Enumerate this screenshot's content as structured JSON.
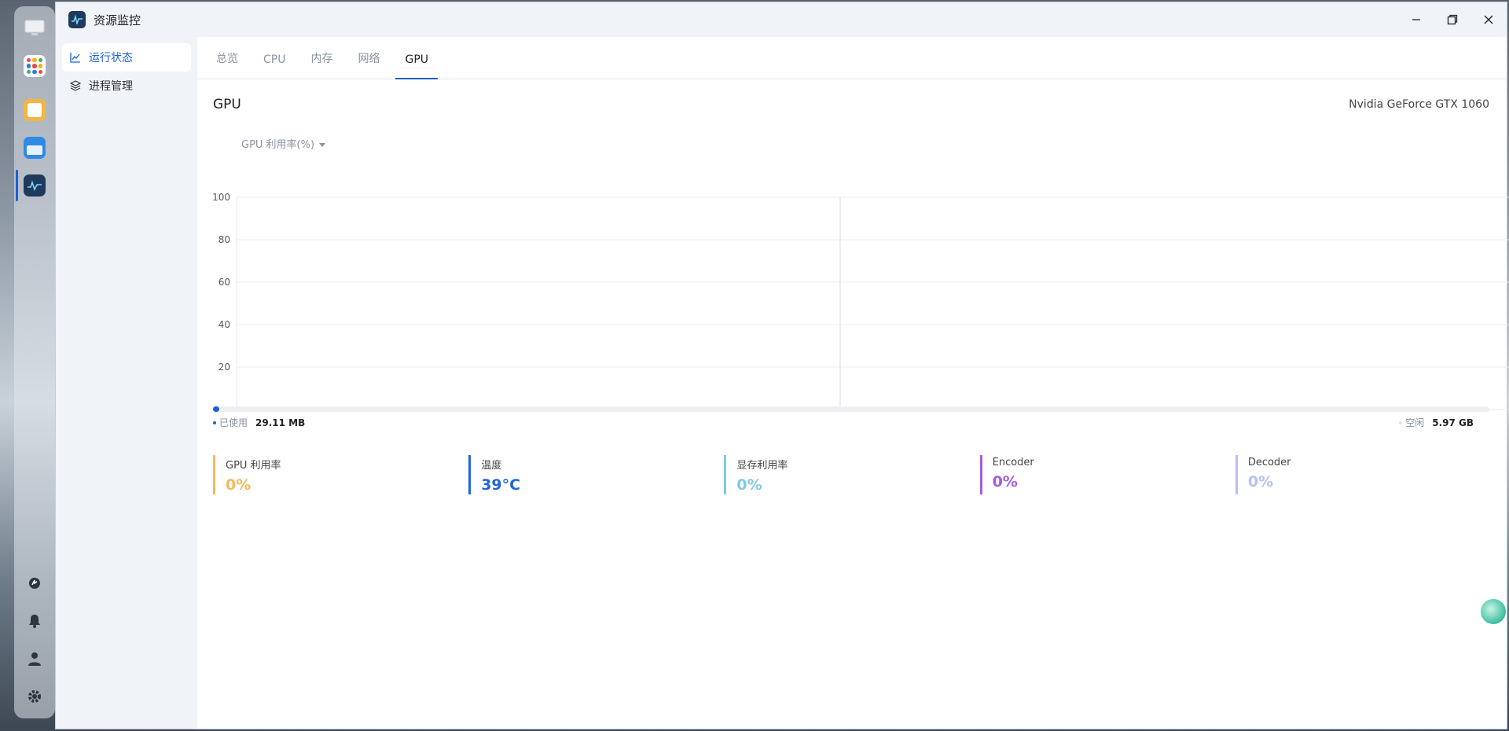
{
  "window": {
    "title": "资源监控"
  },
  "sidebar": {
    "items": [
      {
        "label": "运行状态",
        "icon": "line-chart-icon",
        "active": true
      },
      {
        "label": "进程管理",
        "icon": "layers-icon",
        "active": false
      }
    ]
  },
  "tabs": [
    {
      "label": "总览",
      "active": false
    },
    {
      "label": "CPU",
      "active": false
    },
    {
      "label": "内存",
      "active": false
    },
    {
      "label": "网络",
      "active": false
    },
    {
      "label": "GPU",
      "active": true
    }
  ],
  "section": {
    "title": "GPU",
    "gpu_model": "Nvidia GeForce GTX 1060"
  },
  "metric_select": {
    "value": "GPU 利用率(%)"
  },
  "chart_data": {
    "type": "line",
    "title": "",
    "ylim": [
      0,
      100
    ],
    "y_ticks": [
      "100",
      "80",
      "60",
      "40",
      "20"
    ],
    "series": [
      {
        "values": []
      }
    ],
    "grid": true
  },
  "memory": {
    "used_label": "已使用",
    "used_value": "29.11 MB",
    "free_label": "空闲",
    "free_value": "5.97 GB",
    "used_fraction": 0.005
  },
  "stats": [
    {
      "label": "GPU 利用率",
      "value": "0%",
      "color": "#f4b95a"
    },
    {
      "label": "温度",
      "value": "39°C",
      "color": "#2266d8"
    },
    {
      "label": "显存利用率",
      "value": "0%",
      "color": "#7fcbe0"
    },
    {
      "label": "Encoder",
      "value": "0%",
      "color": "#a55ae0"
    },
    {
      "label": "Decoder",
      "value": "0%",
      "color": "#b8c0f0"
    }
  ],
  "colors": {
    "accent": "#1d5fd6"
  }
}
